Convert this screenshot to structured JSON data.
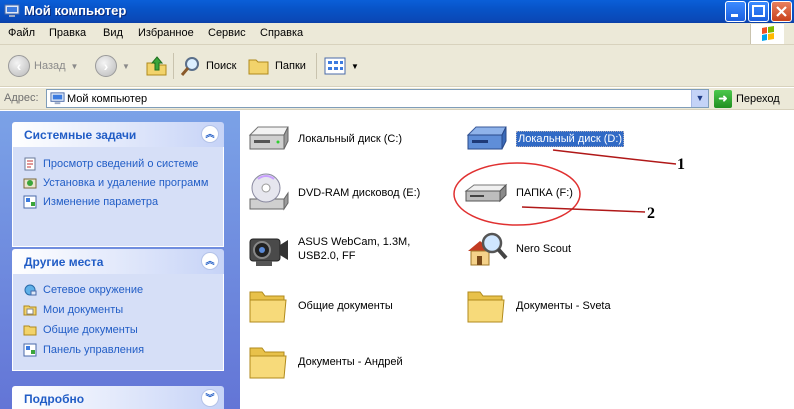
{
  "window": {
    "title": "Мой компьютер"
  },
  "menu": [
    "Файл",
    "Правка",
    "Вид",
    "Избранное",
    "Сервис",
    "Справка"
  ],
  "toolbar": {
    "back_label": "Назад",
    "search_label": "Поиск",
    "folders_label": "Папки"
  },
  "address": {
    "label": "Адрес:",
    "value": "Мой компьютер",
    "go_label": "Переход"
  },
  "panels": {
    "system_tasks": {
      "title": "Системные задачи",
      "items": [
        "Просмотр сведений о системе",
        "Установка и удаление программ",
        "Изменение параметра"
      ]
    },
    "other_places": {
      "title": "Другие места",
      "items": [
        "Сетевое окружение",
        "Мои документы",
        "Общие документы",
        "Панель управления"
      ]
    },
    "details": {
      "title": "Подробно"
    }
  },
  "items": [
    {
      "label": "Локальный диск (C:)",
      "icon": "hard-drive-icon"
    },
    {
      "label": "Локальный диск (D:)",
      "icon": "hard-drive-icon",
      "selected": true
    },
    {
      "label": "DVD-RAM дисковод (E:)",
      "icon": "dvd-drive-icon"
    },
    {
      "label": "ПАПКА (F:)",
      "icon": "removable-drive-icon"
    },
    {
      "label": "ASUS WebCam, 1.3M, USB2.0, FF",
      "icon": "webcam-icon"
    },
    {
      "label": "Nero Scout",
      "icon": "nero-scout-icon"
    },
    {
      "label": "Общие документы",
      "icon": "folder-icon"
    },
    {
      "label": "Документы - Sveta",
      "icon": "folder-icon"
    },
    {
      "label": "Документы - Андрей",
      "icon": "folder-icon"
    }
  ],
  "annotations": [
    "1",
    "2"
  ],
  "colors": {
    "title_bar": "#0a5fd8",
    "task_pane": "#7ba2e7",
    "selection": "#316ac5",
    "annotation_circle": "#e03030"
  }
}
